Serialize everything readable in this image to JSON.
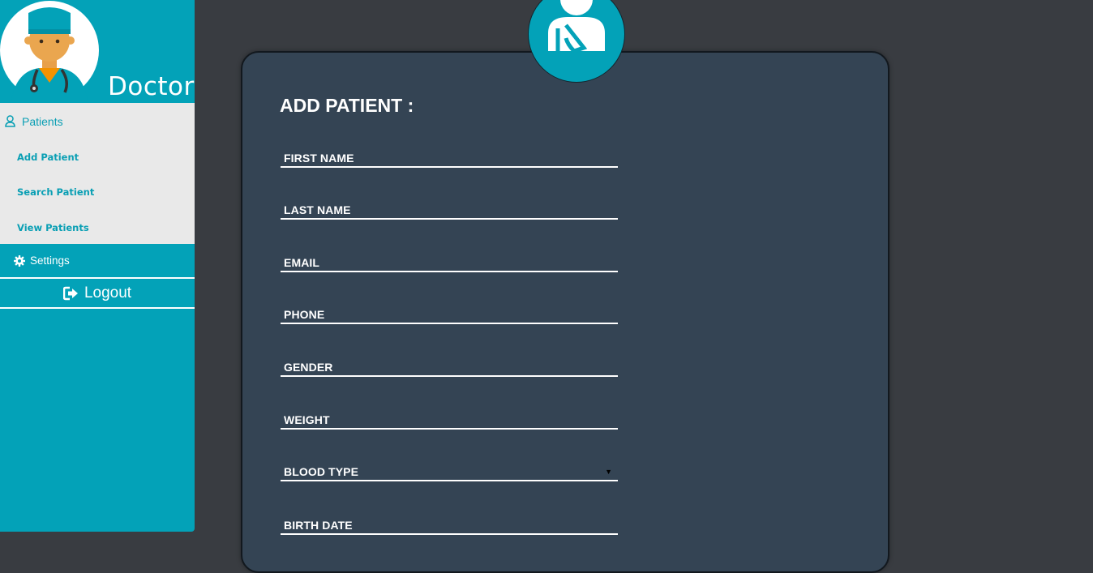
{
  "sidebar": {
    "role_title": "Doctor",
    "menu": {
      "section_label": "Patients",
      "items": [
        {
          "label": "Add Patient"
        },
        {
          "label": "Search Patient"
        },
        {
          "label": "View Patients"
        }
      ]
    },
    "settings_label": "Settings",
    "logout_label": "Logout"
  },
  "form": {
    "title": "ADD PATIENT :",
    "fields": [
      {
        "label": "FIRST NAME"
      },
      {
        "label": "LAST NAME"
      },
      {
        "label": "EMAIL"
      },
      {
        "label": "PHONE"
      },
      {
        "label": "GENDER"
      },
      {
        "label": "WEIGHT"
      },
      {
        "label": "BLOOD TYPE",
        "caret": "▼"
      },
      {
        "label": "BIRTH DATE"
      }
    ]
  },
  "icons": {
    "avatar": "doctor-avatar",
    "badge": "injured-patient-icon",
    "patients": "user-icon",
    "settings": "gear-icon",
    "logout": "sign-out-icon"
  },
  "colors": {
    "accent": "#03a2b8",
    "background": "#393c41",
    "card": "#344454",
    "menu_panel": "#e9e9e9"
  }
}
